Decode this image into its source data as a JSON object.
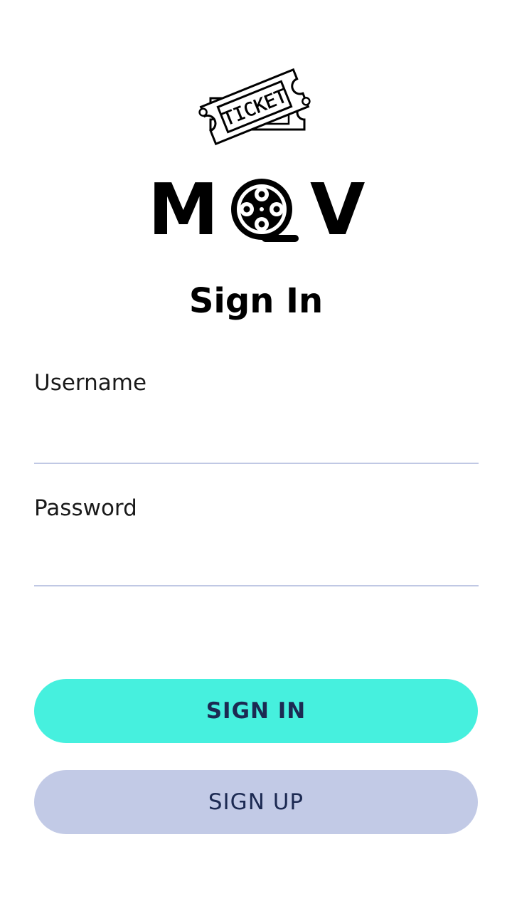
{
  "logo": {
    "ticket_text": "TICKET",
    "brand_left": "M",
    "brand_right": "V",
    "ticket_icon": "ticket-icon",
    "reel_icon": "film-reel-icon"
  },
  "title": "Sign In",
  "form": {
    "username_label": "Username",
    "username_value": "",
    "password_label": "Password",
    "password_value": ""
  },
  "buttons": {
    "sign_in": "SIGN IN",
    "sign_up": "SIGN UP"
  },
  "colors": {
    "primary_button": "#46f0de",
    "secondary_button": "#c2cae6",
    "button_text": "#1c2a52",
    "field_underline": "#c0c8e4"
  }
}
